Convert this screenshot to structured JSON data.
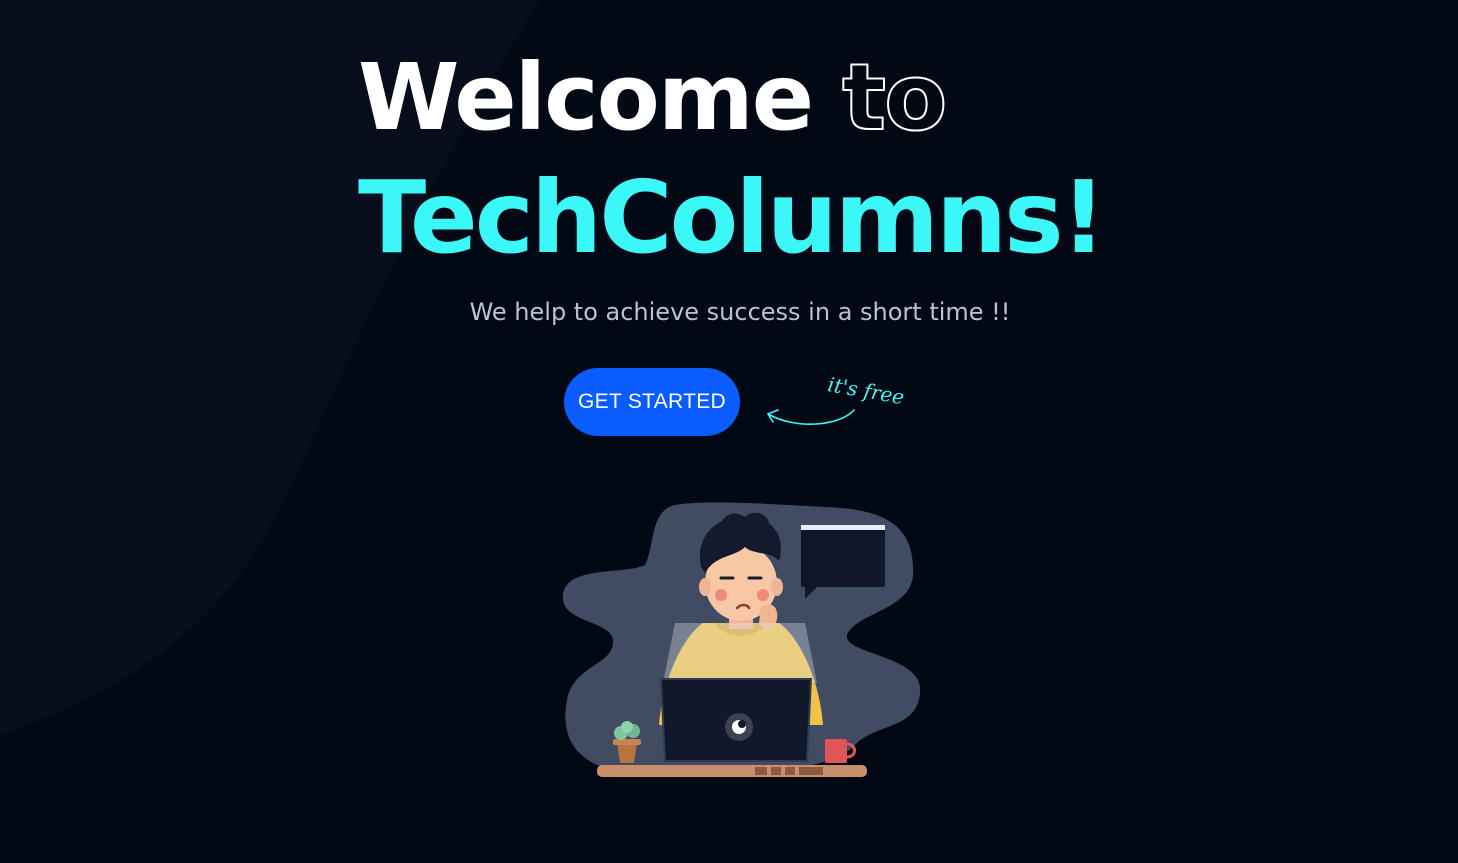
{
  "hero": {
    "title_word1": "Welcome",
    "title_word2": "to",
    "title_line2": "TechColumns!",
    "subtitle": "We help to achieve success in a short time !!"
  },
  "cta": {
    "label": "GET STARTED",
    "note": "it's free"
  },
  "colors": {
    "background": "#020814",
    "accent": "#3cf7f7",
    "button": "#0a5cff",
    "subtitle": "#b8c3d4"
  },
  "illustration": {
    "icon": "person-at-laptop-illustration"
  }
}
